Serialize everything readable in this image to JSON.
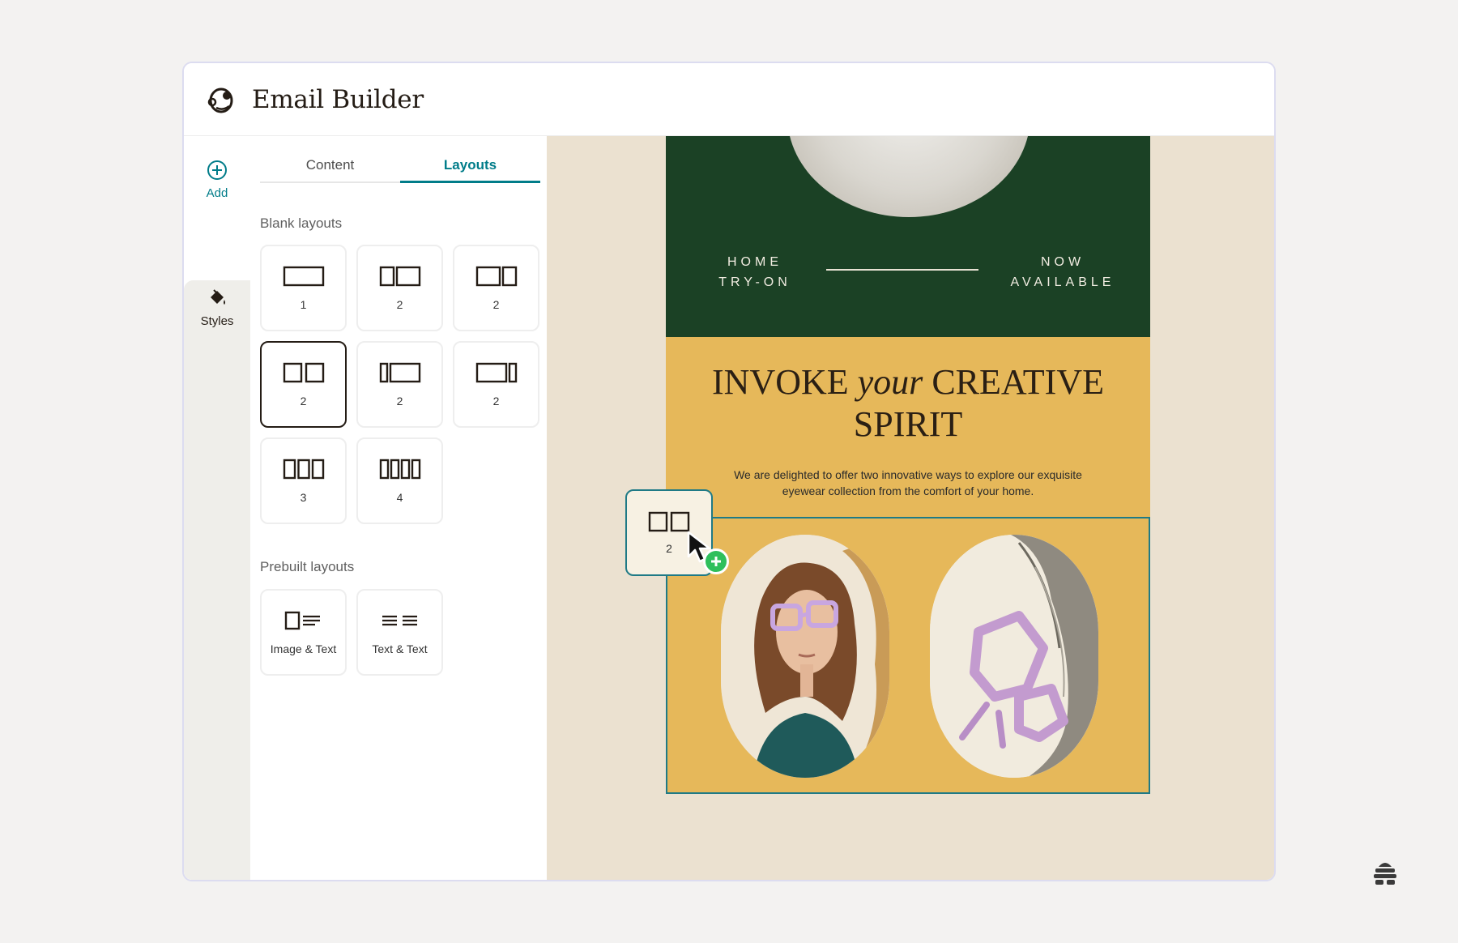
{
  "app": {
    "title": "Email Builder"
  },
  "rail": {
    "add_label": "Add",
    "styles_label": "Styles"
  },
  "panel": {
    "tabs": [
      {
        "label": "Content",
        "active": false
      },
      {
        "label": "Layouts",
        "active": true
      }
    ],
    "blank_title": "Blank layouts",
    "blank_layouts": [
      {
        "icon": "one-column-icon",
        "label": "1"
      },
      {
        "icon": "two-column-narrow-wide-icon",
        "label": "2"
      },
      {
        "icon": "two-column-wide-narrow-icon",
        "label": "2"
      },
      {
        "icon": "two-column-equal-icon",
        "label": "2",
        "selected": true
      },
      {
        "icon": "two-column-sidebar-left-icon",
        "label": "2"
      },
      {
        "icon": "two-column-sidebar-right-icon",
        "label": "2"
      },
      {
        "icon": "three-column-icon",
        "label": "3"
      },
      {
        "icon": "four-column-icon",
        "label": "4"
      }
    ],
    "prebuilt_title": "Prebuilt layouts",
    "prebuilt_layouts": [
      {
        "icon": "image-text-icon",
        "label": "Image & Text"
      },
      {
        "icon": "text-text-icon",
        "label": "Text & Text"
      }
    ]
  },
  "email": {
    "hero_left": [
      "HOME",
      "TRY-ON"
    ],
    "hero_right": [
      "NOW",
      "AVAILABLE"
    ],
    "headline_pre": "INVOKE ",
    "headline_em": "your",
    "headline_post": " CREATIVE SPIRIT",
    "body": "We are delighted to offer two innovative ways to explore our exquisite eyewear collection from the comfort of your home.",
    "colors": {
      "hero_bg": "#1b4125",
      "block_bg": "#e6b85a",
      "canvas_bg": "#ebe1d0",
      "selection": "#1f7a86"
    }
  },
  "drag": {
    "label": "2",
    "icon": "two-column-equal-icon"
  },
  "colors": {
    "accent": "#007c89",
    "add_badge": "#2fbf5b"
  }
}
